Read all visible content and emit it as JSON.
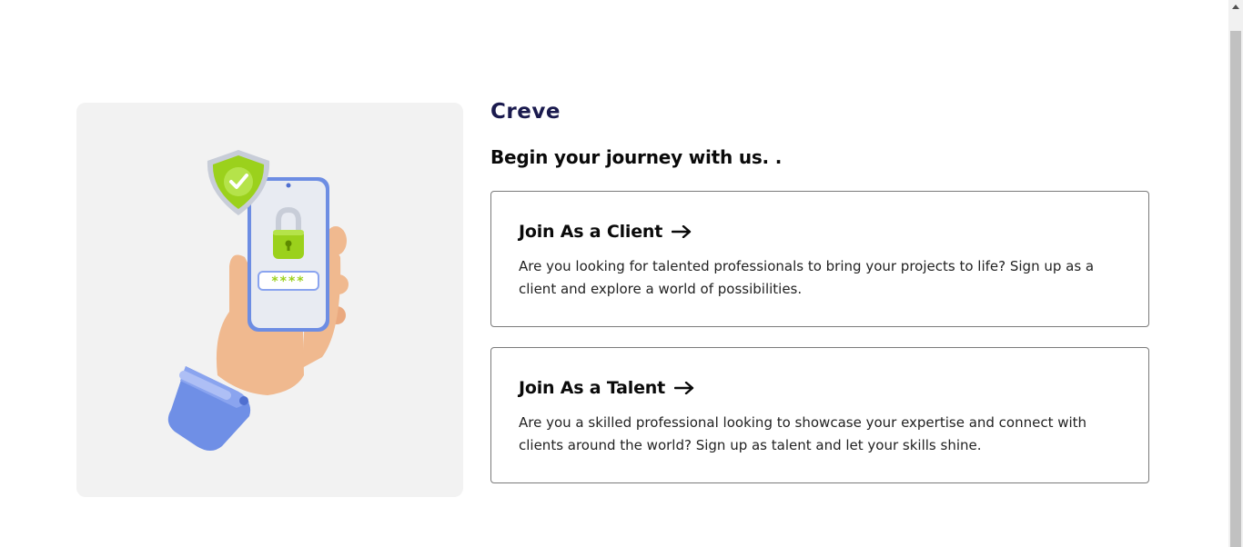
{
  "logo": {
    "text": "Creve"
  },
  "headline": "Begin your journey with us. .",
  "cards": [
    {
      "title": "Join As a Client",
      "description": "Are you looking for talented professionals to bring your projects to life? Sign up as a client and explore a world of possibilities."
    },
    {
      "title": "Join As a Talent",
      "description": "Are you a skilled professional looking to showcase your expertise and connect with clients around the world? Sign up as talent and let your skills shine."
    }
  ],
  "illustration": {
    "password_mask": "****",
    "icons": [
      "shield-check-icon",
      "padlock-icon",
      "smartphone-icon",
      "hand-icon"
    ]
  },
  "colors": {
    "brand": "#1a1a4e",
    "accent_green": "#9bd11c",
    "card_border": "#7a7a7a",
    "panel_bg": "#f2f2f2"
  }
}
